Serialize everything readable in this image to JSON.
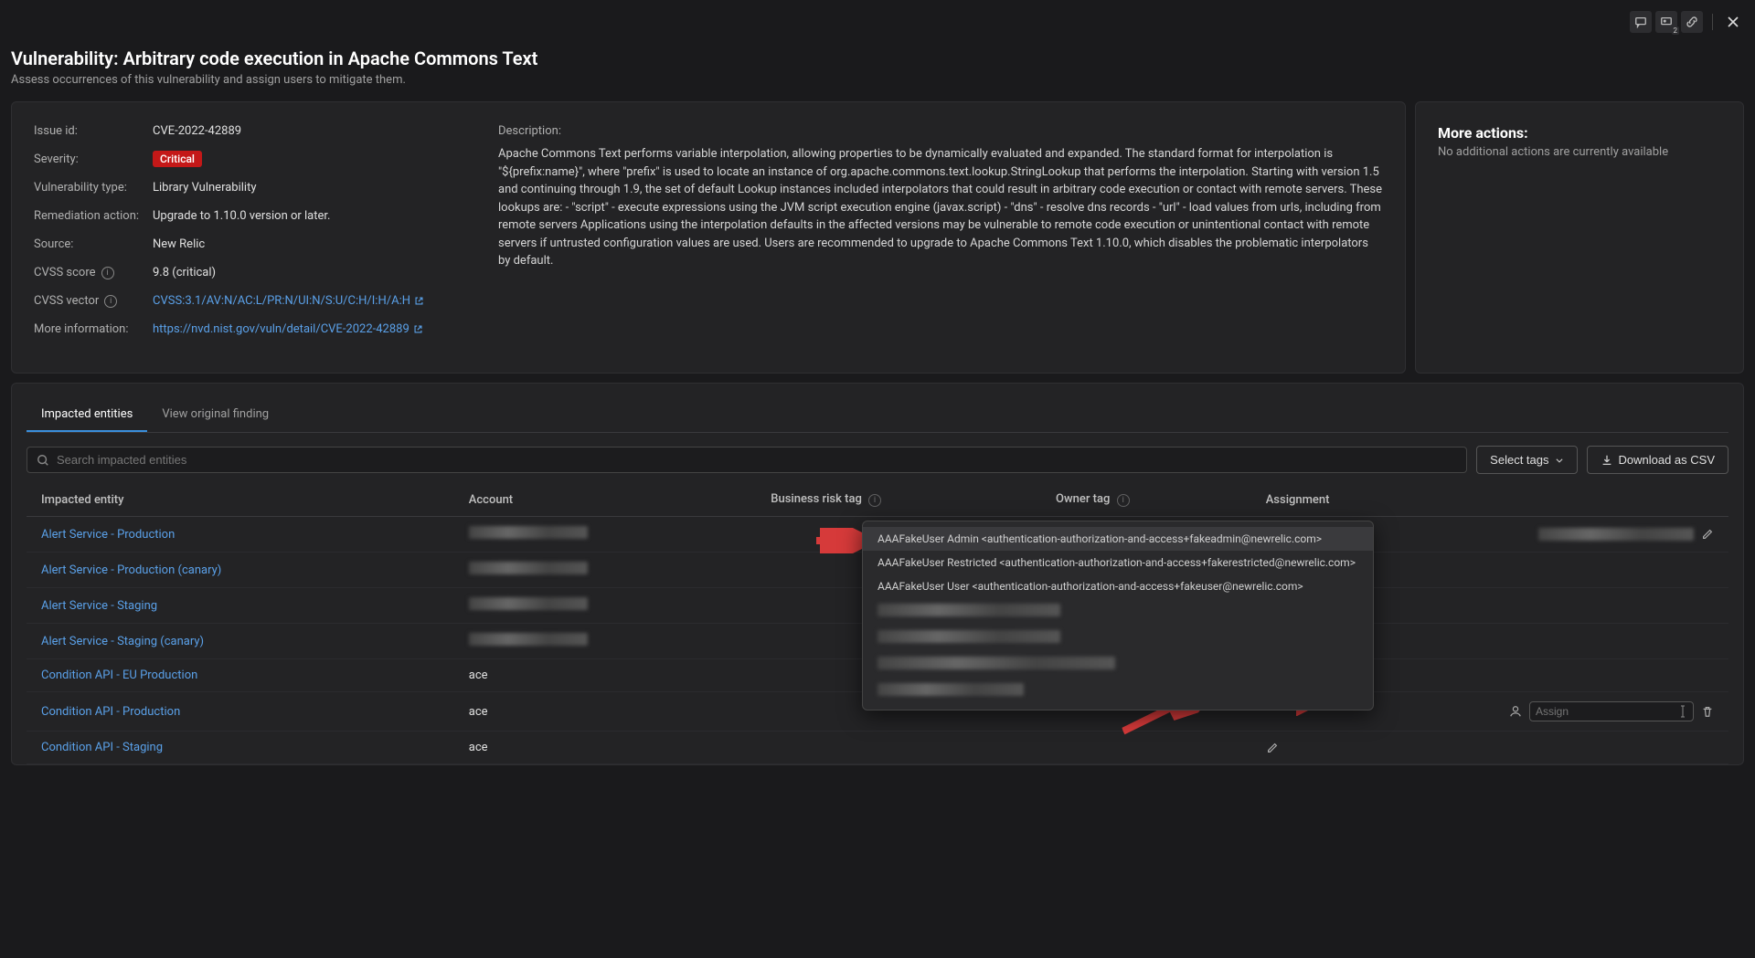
{
  "header": {
    "title": "Vulnerability: Arbitrary code execution in Apache Commons Text",
    "subtitle": "Assess occurrences of this vulnerability and assign users to mitigate them."
  },
  "details": {
    "issue_id_label": "Issue id:",
    "issue_id": "CVE-2022-42889",
    "severity_label": "Severity:",
    "severity": "Critical",
    "vuln_type_label": "Vulnerability type:",
    "vuln_type": "Library Vulnerability",
    "remediation_label": "Remediation action:",
    "remediation": "Upgrade to 1.10.0 version or later.",
    "source_label": "Source:",
    "source": "New Relic",
    "cvss_score_label": "CVSS score",
    "cvss_score": "9.8 (critical)",
    "cvss_vector_label": "CVSS vector",
    "cvss_vector": "CVSS:3.1/AV:N/AC:L/PR:N/UI:N/S:U/C:H/I:H/A:H",
    "more_info_label": "More information:",
    "more_info": "https://nvd.nist.gov/vuln/detail/CVE-2022-42889"
  },
  "description": {
    "label": "Description:",
    "text": "Apache Commons Text performs variable interpolation, allowing properties to be dynamically evaluated and expanded. The standard format for interpolation is \"${prefix:name}\", where \"prefix\" is used to locate an instance of org.apache.commons.text.lookup.StringLookup that performs the interpolation. Starting with version 1.5 and continuing through 1.9, the set of default Lookup instances included interpolators that could result in arbitrary code execution or contact with remote servers. These lookups are: - \"script\" - execute expressions using the JVM script execution engine (javax.script) - \"dns\" - resolve dns records - \"url\" - load values from urls, including from remote servers Applications using the interpolation defaults in the affected versions may be vulnerable to remote code execution or unintentional contact with remote servers if untrusted configuration values are used. Users are recommended to upgrade to Apache Commons Text 1.10.0, which disables the problematic interpolators by default."
  },
  "more_actions": {
    "title": "More actions:",
    "text": "No additional actions are currently available"
  },
  "tabs": {
    "impacted": "Impacted entities",
    "original": "View original finding"
  },
  "search": {
    "placeholder": "Search impacted entities"
  },
  "buttons": {
    "select_tags": "Select tags",
    "download_csv": "Download as CSV"
  },
  "columns": {
    "entity": "Impacted entity",
    "account": "Account",
    "business_risk": "Business risk tag",
    "owner_tag": "Owner tag",
    "assignment": "Assignment"
  },
  "rows": [
    {
      "entity": "Alert Service - Production",
      "account": "blur",
      "assignment": "blur"
    },
    {
      "entity": "Alert Service - Production (canary)",
      "account": "blur"
    },
    {
      "entity": "Alert Service - Staging",
      "account": "blur"
    },
    {
      "entity": "Alert Service - Staging (canary)",
      "account": "blur"
    },
    {
      "entity": "Condition API - EU Production",
      "account": "ace"
    },
    {
      "entity": "Condition API - Production",
      "account": "ace",
      "assign_input": true
    },
    {
      "entity": "Condition API - Staging",
      "account": "ace"
    }
  ],
  "assign_placeholder": "Assign",
  "dropdown": {
    "items": [
      "AAAFakeUser Admin <authentication-authorization-and-access+fakeadmin@newrelic.com>",
      "AAAFakeUser Restricted <authentication-authorization-and-access+fakerestricted@newrelic.com>",
      "AAAFakeUser User <authentication-authorization-and-access+fakeuser@newrelic.com>"
    ]
  }
}
